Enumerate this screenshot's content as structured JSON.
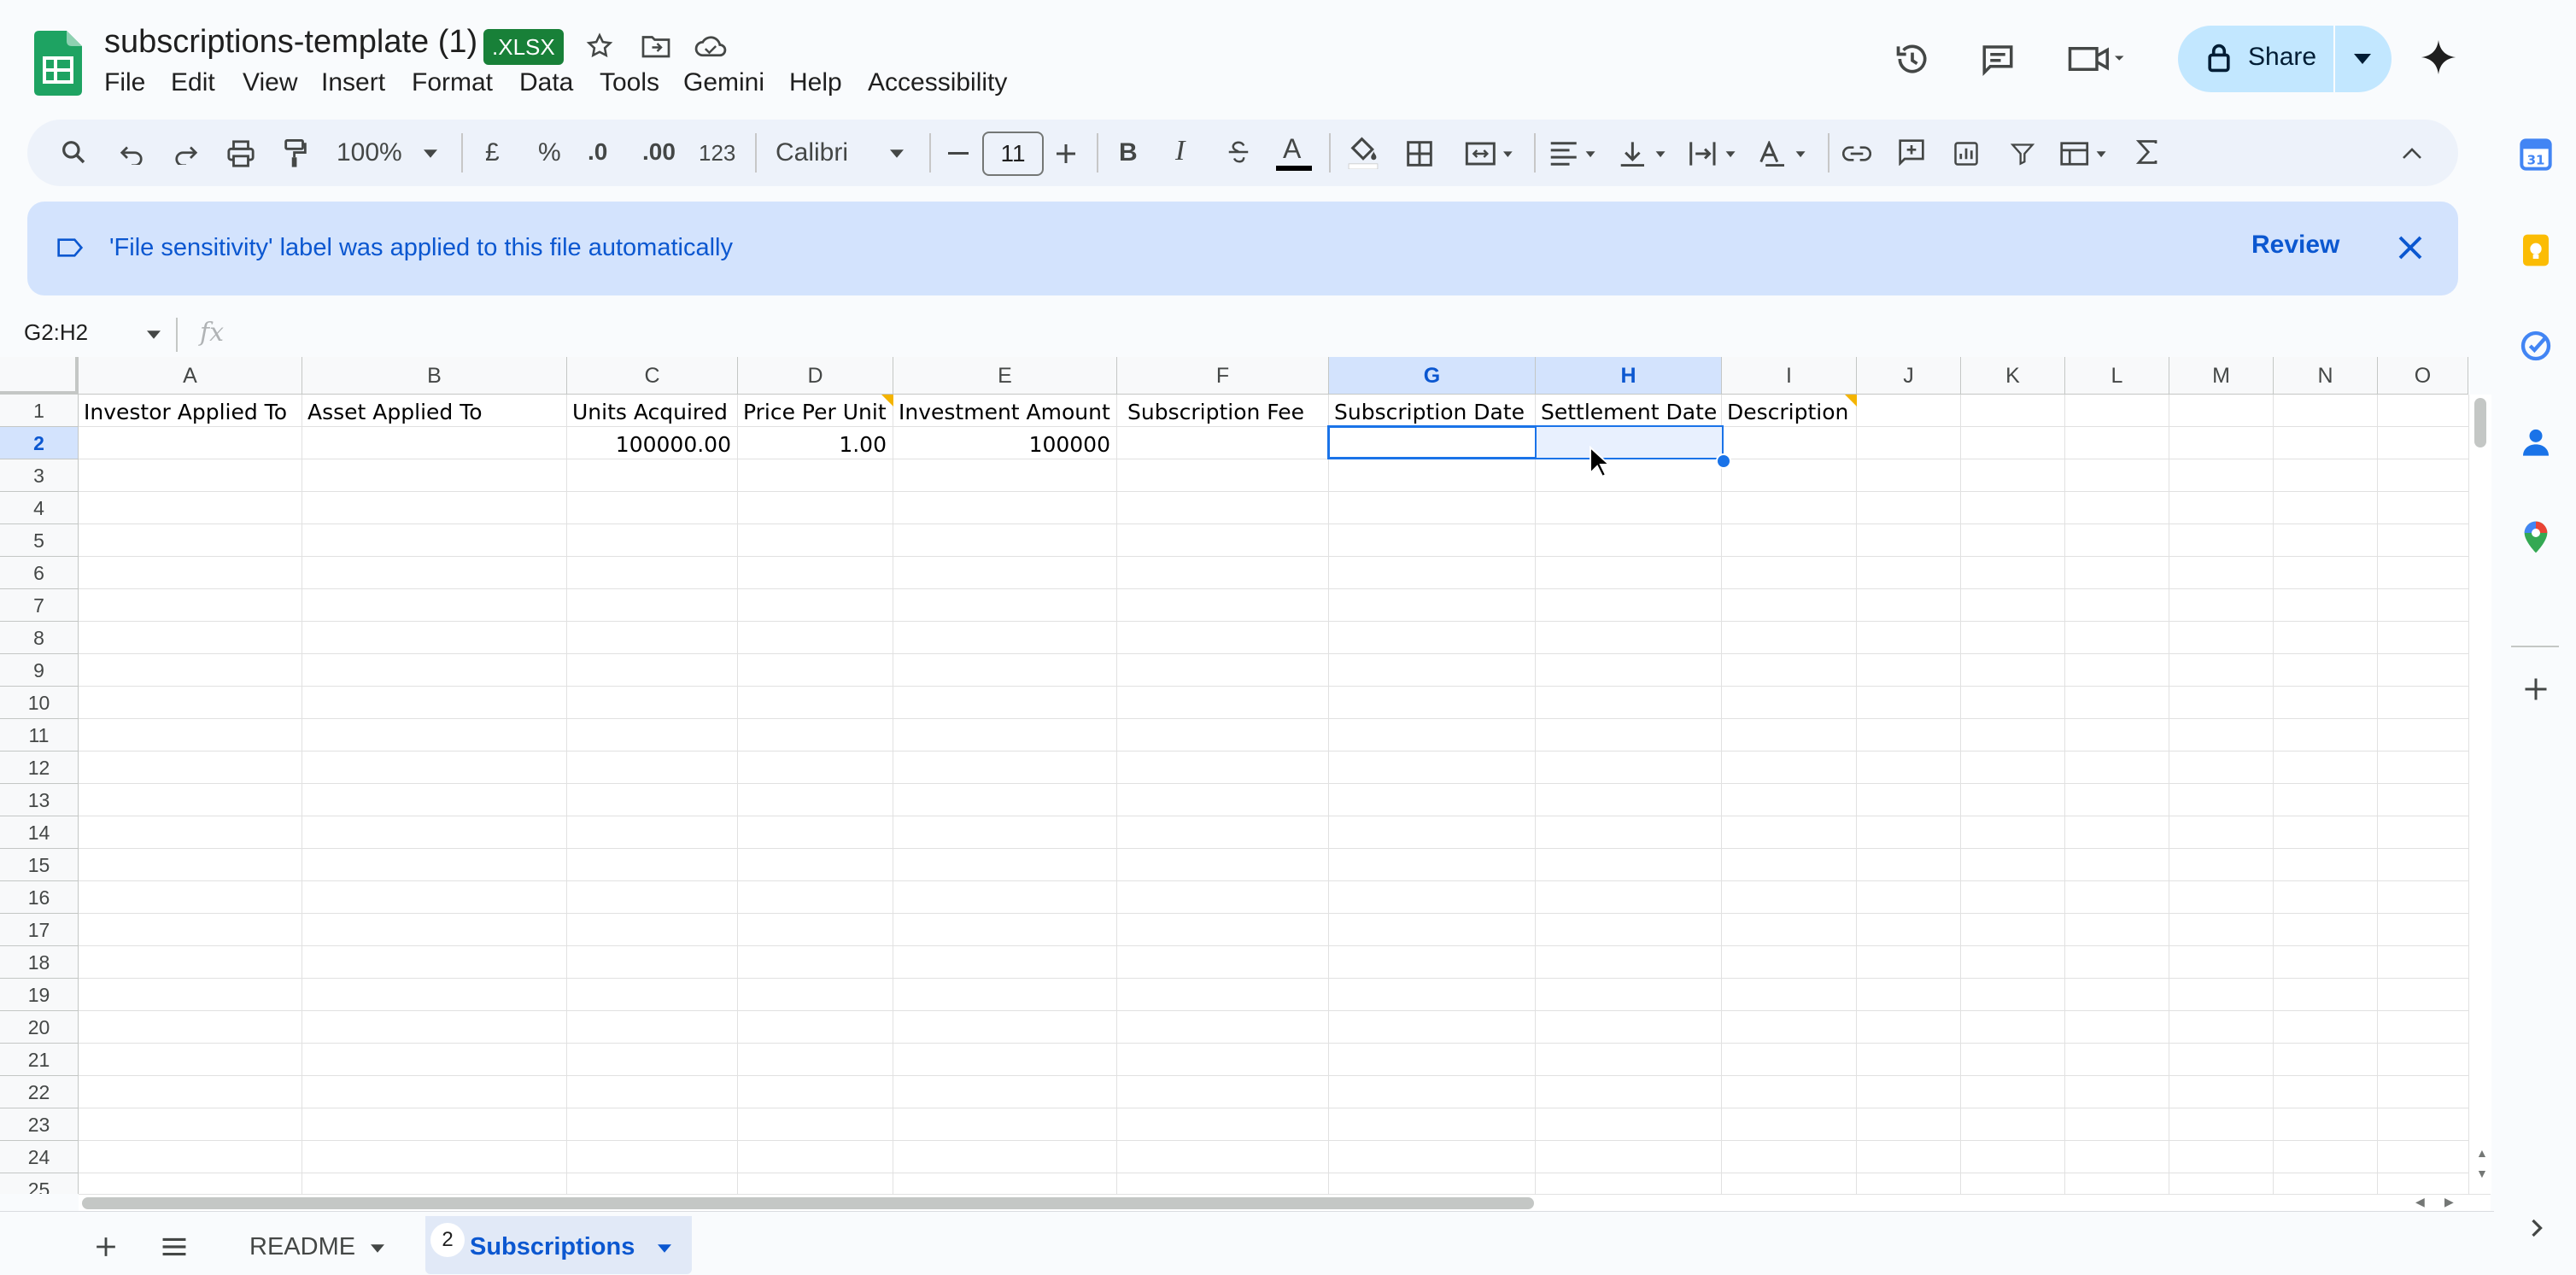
{
  "header": {
    "title": "subscriptions-template (1)",
    "badge": ".XLSX",
    "share_label": "Share"
  },
  "menu": [
    "File",
    "Edit",
    "View",
    "Insert",
    "Format",
    "Data",
    "Tools",
    "Gemini",
    "Help",
    "Accessibility"
  ],
  "toolbar": {
    "zoom": "100%",
    "currency": "£",
    "percent": "%",
    "dec_decrease": ".0",
    "dec_increase": ".00",
    "number_format": "123",
    "font": "Calibri",
    "font_size": "11",
    "bold": "B",
    "italic": "I",
    "text_color_glyph": "A"
  },
  "banner": {
    "text": "'File sensitivity' label was applied to this file automatically",
    "review_label": "Review"
  },
  "formula_bar": {
    "name_box": "G2:H2",
    "fx": "fx"
  },
  "grid": {
    "columns": [
      "A",
      "B",
      "C",
      "D",
      "E",
      "F",
      "G",
      "H",
      "I",
      "J",
      "K",
      "L",
      "M",
      "N",
      "O"
    ],
    "rows": [
      "1",
      "2",
      "3",
      "4",
      "5",
      "6",
      "7",
      "8",
      "9",
      "10",
      "11",
      "12",
      "13",
      "14",
      "15",
      "16",
      "17",
      "18",
      "19",
      "20",
      "21",
      "22",
      "23",
      "24",
      "25"
    ],
    "selected_columns": [
      "G",
      "H"
    ],
    "selected_row": "2",
    "headers": {
      "A": "Investor Applied To",
      "B": "Asset Applied To",
      "C": "Units Acquired",
      "D": "Price Per Unit",
      "E": "Investment Amount",
      "F": "Subscription Fee",
      "G": "Subscription Date",
      "H": "Settlement Date",
      "I": "Description"
    },
    "row2": {
      "C": "100000.00",
      "D": "1.00",
      "E": "100000"
    }
  },
  "sheets": {
    "tabs": [
      {
        "label": "README",
        "active": false
      },
      {
        "label": "Subscriptions",
        "active": true,
        "badge": "2"
      }
    ]
  },
  "colors": {
    "accent": "#0b57d0",
    "banner_bg": "#d3e3fd",
    "sheets_green": "#188038",
    "share_bg": "#c2e7ff",
    "comment_marker": "#f4b400"
  }
}
